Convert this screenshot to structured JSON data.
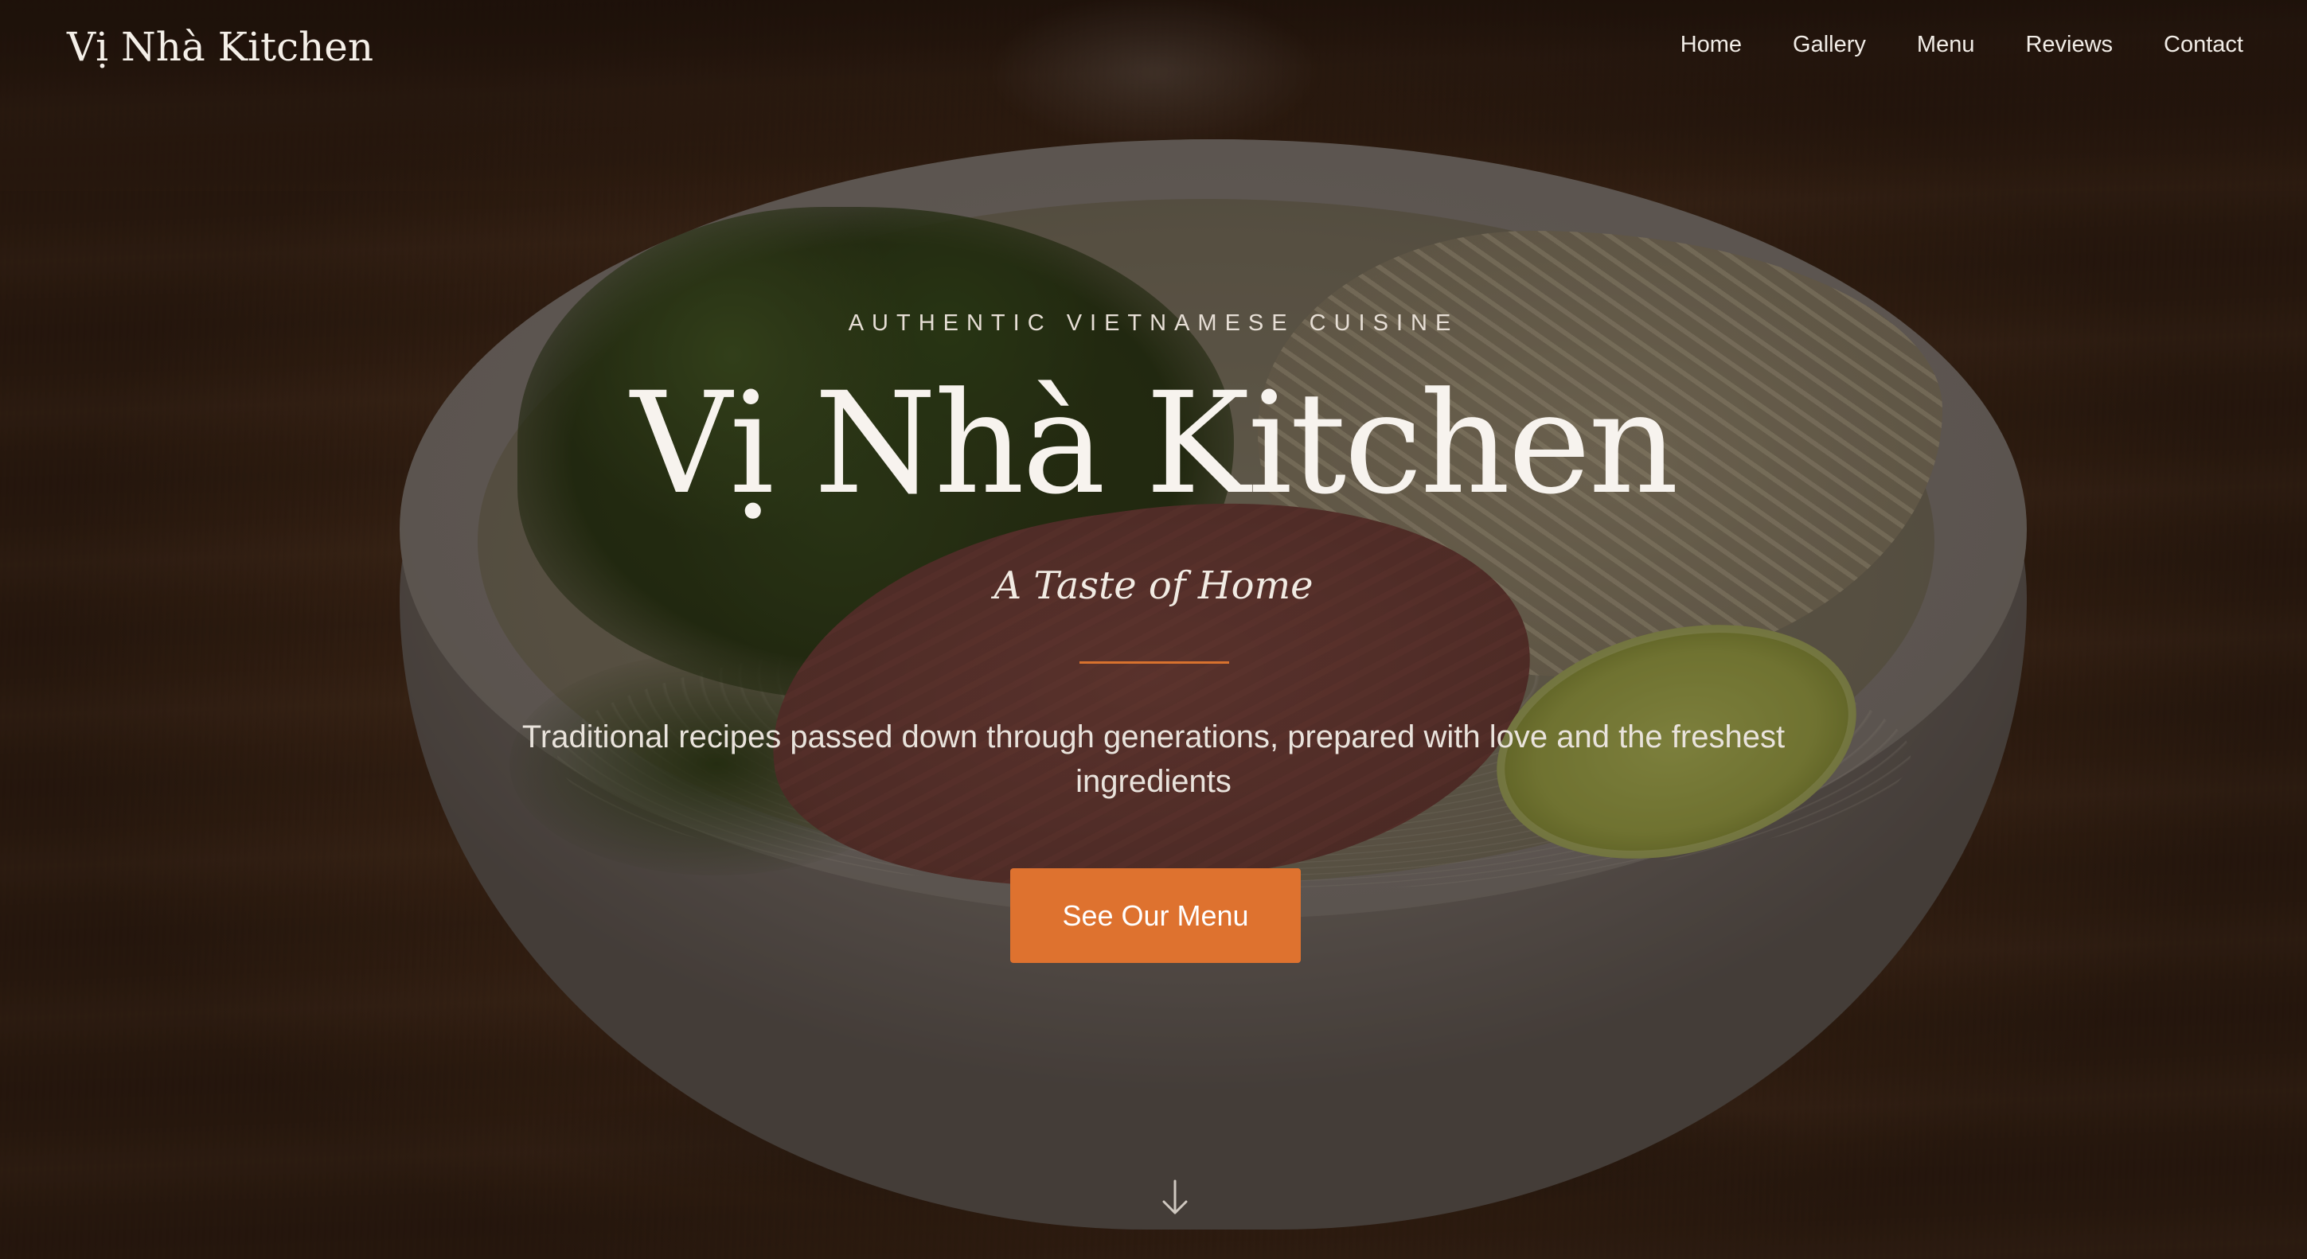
{
  "brand": {
    "logo_text": "Vị Nhà Kitchen",
    "accent_color": "#de722f"
  },
  "nav": {
    "items": [
      {
        "label": "Home"
      },
      {
        "label": "Gallery"
      },
      {
        "label": "Menu"
      },
      {
        "label": "Reviews"
      },
      {
        "label": "Contact"
      }
    ]
  },
  "hero": {
    "eyebrow": "AUTHENTIC VIETNAMESE CUISINE",
    "title": "Vị Nhà Kitchen",
    "tagline": "A Taste of Home",
    "description": "Traditional recipes passed down through generations, prepared with love and the freshest ingredients",
    "cta_label": "See Our Menu",
    "scroll_icon": "arrow-down-icon",
    "background_image": "bowl of pho on wooden table"
  }
}
